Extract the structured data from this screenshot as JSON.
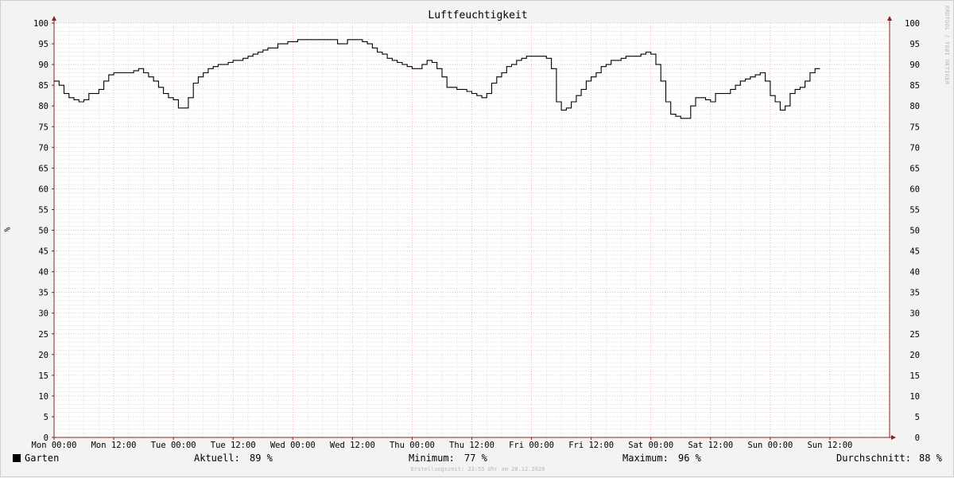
{
  "chart_data": {
    "type": "line",
    "title": "Luftfeuchtigkeit",
    "ylabel": "%",
    "ylim": [
      0,
      100
    ],
    "y_ticks": [
      0,
      5,
      10,
      15,
      20,
      25,
      30,
      35,
      40,
      45,
      50,
      55,
      60,
      65,
      70,
      75,
      80,
      85,
      90,
      95,
      100
    ],
    "x_tick_labels": [
      "Mon 00:00",
      "Mon 12:00",
      "Tue 00:00",
      "Tue 12:00",
      "Wed 00:00",
      "Wed 12:00",
      "Thu 00:00",
      "Thu 12:00",
      "Fri 00:00",
      "Fri 12:00",
      "Sat 00:00",
      "Sat 12:00",
      "Sun 00:00",
      "Sun 12:00"
    ],
    "xlim_hours": [
      0,
      168
    ],
    "grid": true,
    "step": true,
    "series": [
      {
        "name": "Garten",
        "color": "#000000",
        "x_hours": [
          0,
          1,
          2,
          3,
          4,
          5,
          6,
          7,
          8,
          9,
          10,
          11,
          12,
          13,
          14,
          15,
          16,
          17,
          18,
          19,
          20,
          21,
          22,
          23,
          24,
          25,
          26,
          27,
          28,
          29,
          30,
          31,
          32,
          33,
          34,
          35,
          36,
          37,
          38,
          39,
          40,
          41,
          42,
          43,
          44,
          45,
          46,
          47,
          48,
          49,
          50,
          51,
          52,
          53,
          54,
          55,
          56,
          57,
          58,
          59,
          60,
          61,
          62,
          63,
          64,
          65,
          66,
          67,
          68,
          69,
          70,
          71,
          72,
          73,
          74,
          75,
          76,
          77,
          78,
          79,
          80,
          81,
          82,
          83,
          84,
          85,
          86,
          87,
          88,
          89,
          90,
          91,
          92,
          93,
          94,
          95,
          96,
          97,
          98,
          99,
          100,
          101,
          102,
          103,
          104,
          105,
          106,
          107,
          108,
          109,
          110,
          111,
          112,
          113,
          114,
          115,
          116,
          117,
          118,
          119,
          120,
          121,
          122,
          123,
          124,
          125,
          126,
          127,
          128,
          129,
          130,
          131,
          132,
          133,
          134,
          135,
          136,
          137,
          138,
          139,
          140,
          141,
          142,
          143,
          144,
          145,
          146,
          147,
          148,
          149,
          150,
          151,
          152,
          153,
          154,
          155,
          156,
          157,
          158,
          159,
          160,
          161,
          162,
          163,
          164,
          165,
          166,
          167,
          168
        ],
        "values": [
          86,
          85,
          83,
          82,
          81.5,
          81,
          81.5,
          83,
          83,
          84,
          86,
          87.5,
          88,
          88,
          88,
          88,
          88.5,
          89,
          88,
          87,
          86,
          84.5,
          83,
          82,
          81.5,
          79.5,
          79.5,
          82,
          85.5,
          87,
          88,
          89,
          89.5,
          90,
          90,
          90.5,
          91,
          91,
          91.5,
          92,
          92.5,
          93,
          93.5,
          94,
          94,
          95,
          95,
          95.5,
          95.5,
          96,
          96,
          96,
          96,
          96,
          96,
          96,
          96,
          95,
          95,
          96,
          96,
          96,
          95.5,
          95,
          94,
          93,
          92.5,
          91.5,
          91,
          90.5,
          90,
          89.5,
          89,
          89,
          90,
          91,
          90.5,
          89,
          87,
          84.5,
          84.5,
          84,
          84,
          83.5,
          83,
          82.5,
          82,
          83,
          85.5,
          87,
          88,
          89.5,
          90,
          91,
          91.5,
          92,
          92,
          92,
          92,
          91.5,
          89,
          81,
          79,
          79.5,
          81,
          82.5,
          84,
          86,
          87,
          88,
          89.5,
          90,
          91,
          91,
          91.5,
          92,
          92,
          92,
          92.5,
          93,
          92.5,
          90,
          86,
          81,
          78,
          77.5,
          77,
          77,
          80,
          82,
          82,
          81.5,
          81,
          83,
          83,
          83,
          84,
          85,
          86,
          86.5,
          87,
          87.5,
          88,
          86,
          82.5,
          81,
          79,
          80,
          83,
          84,
          84.5,
          86,
          88,
          89
        ]
      }
    ],
    "stats": {
      "aktuell_label": "Aktuell:",
      "aktuell_value": "89 %",
      "minimum_label": "Minimum:",
      "minimum_value": "77 %",
      "maximum_label": "Maximum:",
      "maximum_value": "96 %",
      "durchschnitt_label": "Durchschnitt:",
      "durchschnitt_value": "88 %"
    },
    "colors": {
      "background": "#f3f3f3",
      "plot_background": "#ffffff",
      "major_grid": "#f0a0a0",
      "minor_grid": "#d8d8d8",
      "axis": "#8b2222",
      "line": "#000000"
    }
  },
  "legend_name": "Garten",
  "watermark": "RRDTOOL / TOBI OETIKER",
  "footer": "Erstellungszeit: 23:55 Uhr am 20.12.2020"
}
